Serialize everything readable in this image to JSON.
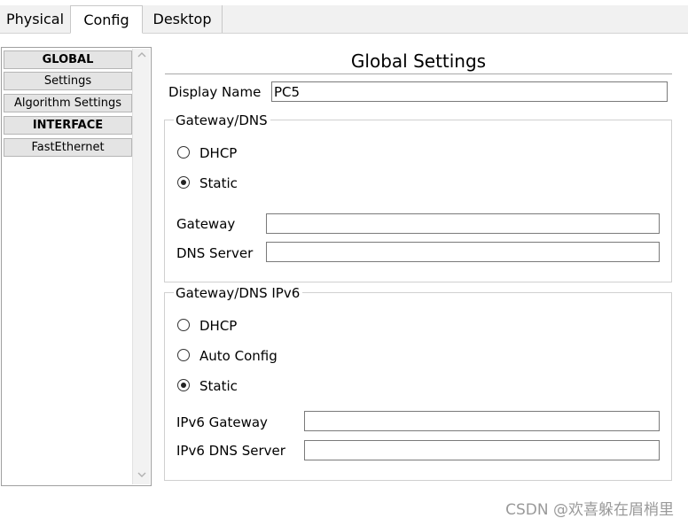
{
  "tabs": [
    {
      "label": "Physical",
      "active": false
    },
    {
      "label": "Config",
      "active": true
    },
    {
      "label": "Desktop",
      "active": false
    }
  ],
  "sidebar": {
    "items": [
      {
        "label": "GLOBAL",
        "header": true
      },
      {
        "label": "Settings",
        "header": false
      },
      {
        "label": "Algorithm Settings",
        "header": false
      },
      {
        "label": "INTERFACE",
        "header": true
      },
      {
        "label": "FastEthernet",
        "header": false
      }
    ],
    "scroll_up_icon": "chevron-up-icon",
    "scroll_down_icon": "chevron-down-icon"
  },
  "main": {
    "title": "Global Settings",
    "display_name": {
      "label": "Display Name",
      "value": "PC5"
    },
    "ipv4": {
      "legend": "Gateway/DNS",
      "options": [
        {
          "label": "DHCP",
          "selected": false
        },
        {
          "label": "Static",
          "selected": true
        }
      ],
      "gateway": {
        "label": "Gateway",
        "value": ""
      },
      "dns": {
        "label": "DNS Server",
        "value": ""
      }
    },
    "ipv6": {
      "legend": "Gateway/DNS IPv6",
      "options": [
        {
          "label": "DHCP",
          "selected": false
        },
        {
          "label": "Auto Config",
          "selected": false
        },
        {
          "label": "Static",
          "selected": true
        }
      ],
      "gateway": {
        "label": "IPv6 Gateway",
        "value": ""
      },
      "dns": {
        "label": "IPv6 DNS Server",
        "value": ""
      }
    }
  },
  "watermark": "CSDN @欢喜躲在眉梢里",
  "colors": {
    "tab_bar": "#f1f1f1",
    "list_item": "#e4e4e4",
    "watermark": "#9a9a9a"
  }
}
